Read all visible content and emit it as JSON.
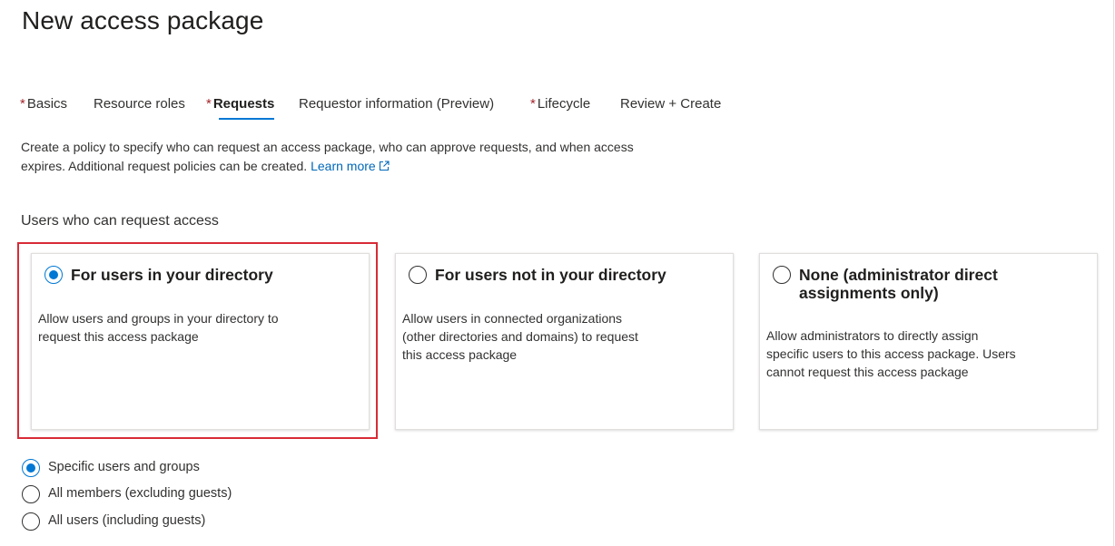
{
  "page": {
    "title": "New access package"
  },
  "tabs": [
    {
      "label": "Basics",
      "required": "*",
      "active": false
    },
    {
      "label": "Resource roles",
      "required": "",
      "active": false
    },
    {
      "label": "Requests",
      "required": "*",
      "active": true
    },
    {
      "label": "Requestor information (Preview)",
      "required": "",
      "active": false
    },
    {
      "label": "Lifecycle",
      "required": "*",
      "active": false
    },
    {
      "label": "Review + Create",
      "required": "",
      "active": false
    }
  ],
  "description": {
    "line1": "Create a policy to specify who can request an access package, who can approve requests, and when access",
    "line2": "expires. Additional request policies can be created.",
    "link": "Learn more"
  },
  "section": {
    "heading": "Users who can request access"
  },
  "cards": [
    {
      "title": "For users in your directory",
      "desc_line1": "Allow users and groups in your directory to",
      "desc_line2": "request this access package",
      "desc_line3": "",
      "selected": true
    },
    {
      "title": "For users not in your directory",
      "desc_line1": "Allow users in connected organizations",
      "desc_line2": "(other directories and domains) to request",
      "desc_line3": "this access package",
      "selected": false
    },
    {
      "title_line1": "None (administrator direct",
      "title_line2": "assignments only)",
      "desc_line1": "Allow administrators to directly assign",
      "desc_line2": "specific users to this access package. Users",
      "desc_line3": "cannot request this access package",
      "selected": false
    }
  ],
  "options": [
    {
      "label": "Specific users and groups",
      "selected": true
    },
    {
      "label": "All members (excluding guests)",
      "selected": false
    },
    {
      "label": "All users (including guests)",
      "selected": false
    }
  ],
  "colors": {
    "accent": "#0078d4",
    "link": "#0067b8",
    "required_marker": "#a4262c",
    "highlight_border": "#d82b37"
  },
  "icons": {
    "external_link": "external-link-icon"
  }
}
